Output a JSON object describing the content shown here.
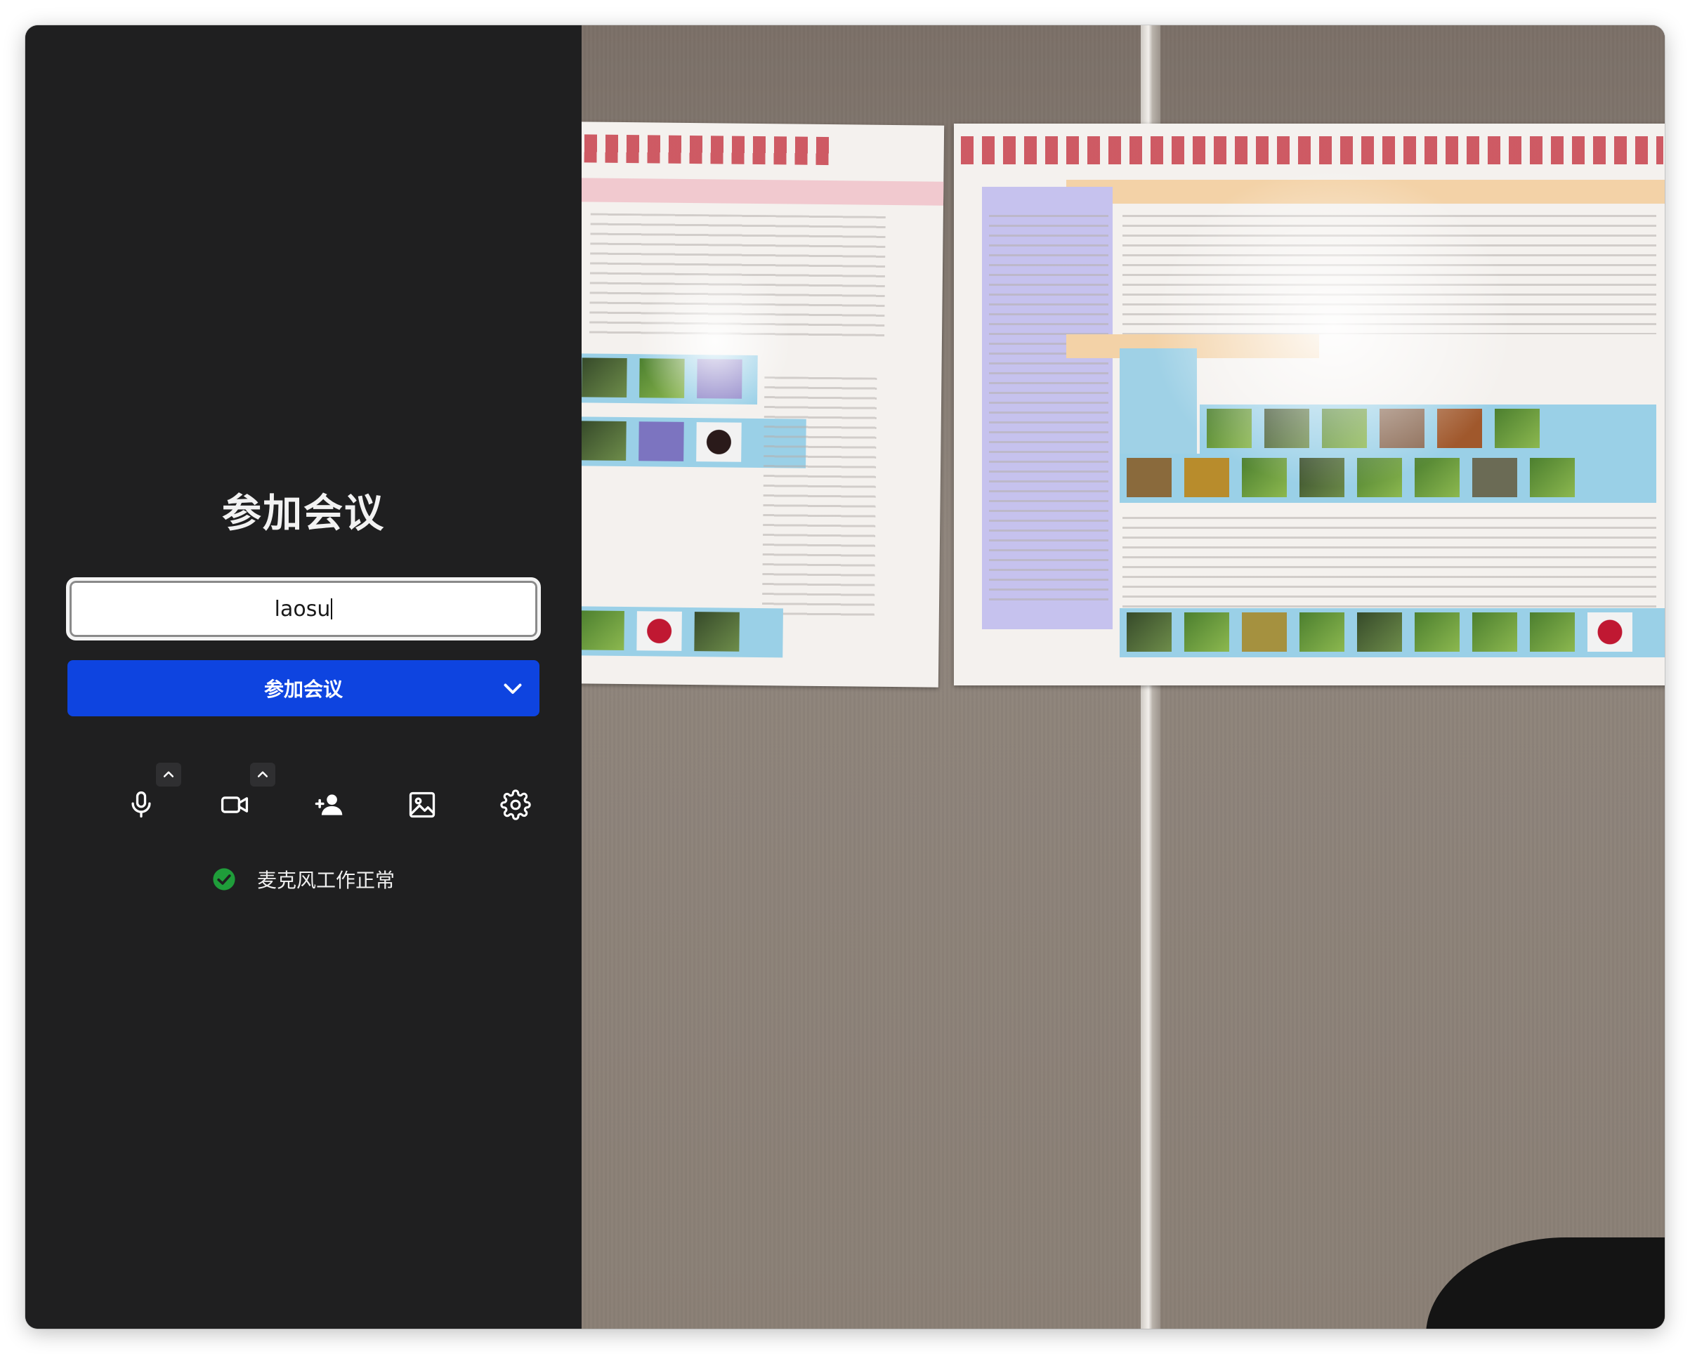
{
  "join_panel": {
    "title": "参加会议",
    "name_input": {
      "value": "laosu",
      "placeholder": ""
    },
    "join_button_label": "参加会议",
    "status_text": "麦克风工作正常"
  },
  "toolbar": {
    "items": [
      {
        "name": "microphone",
        "icon": "mic-icon",
        "has_menu": true
      },
      {
        "name": "camera",
        "icon": "video-camera-icon",
        "has_menu": true
      },
      {
        "name": "invite",
        "icon": "add-person-icon",
        "has_menu": false
      },
      {
        "name": "background",
        "icon": "image-icon",
        "has_menu": false
      },
      {
        "name": "settings",
        "icon": "gear-icon",
        "has_menu": false
      }
    ]
  },
  "colors": {
    "panel_bg": "#1f1f20",
    "primary_button": "#0e44e0",
    "status_ok": "#1f9d3a"
  }
}
